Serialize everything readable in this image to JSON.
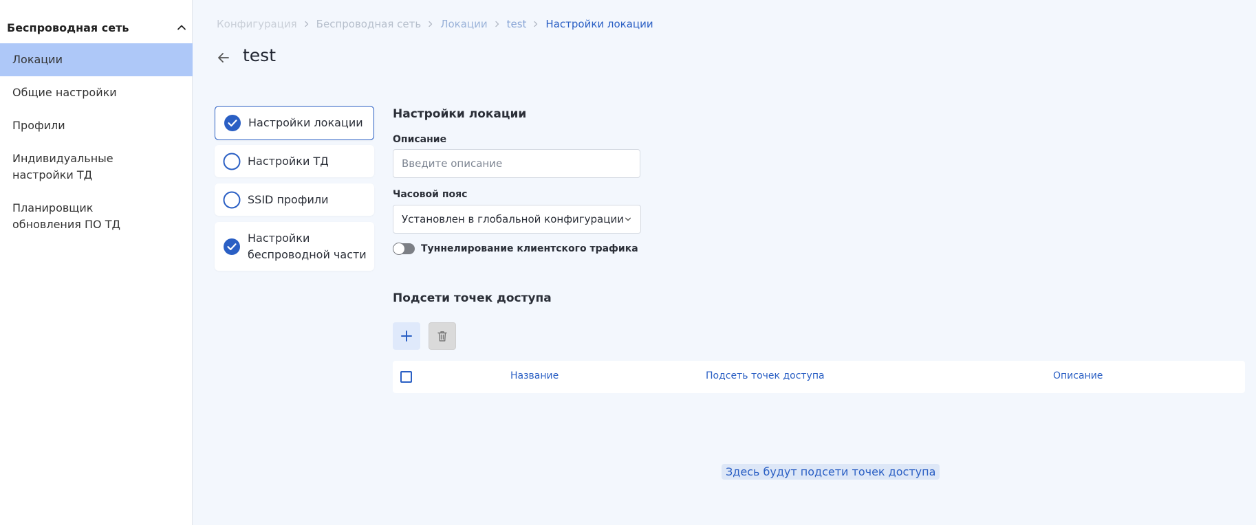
{
  "sidebar": {
    "group_title": "Беспроводная сеть",
    "items": [
      {
        "label": "Локации"
      },
      {
        "label": "Общие настройки"
      },
      {
        "label": "Профили"
      },
      {
        "label": "Индивидуальные",
        "label2": "настройки ТД"
      },
      {
        "label": "Планировщик",
        "label2": "обновления ПО ТД"
      }
    ]
  },
  "breadcrumb": [
    "Конфигурация",
    "Беспроводная сеть",
    "Локации",
    "test",
    "Настройки локации"
  ],
  "page": {
    "title": "test"
  },
  "steps": [
    {
      "label": "Настройки локации",
      "state": "done"
    },
    {
      "label": "Настройки ТД",
      "state": "pending"
    },
    {
      "label": "SSID профили",
      "state": "pending"
    },
    {
      "label": "Настройки",
      "label2": "беспроводной части",
      "state": "done"
    }
  ],
  "form": {
    "section_title": "Настройки локации",
    "description_label": "Описание",
    "description_placeholder": "Введите описание",
    "description_value": "",
    "timezone_label": "Часовой пояс",
    "timezone_value": "Установлен в глобальной конфигурации",
    "tunneling_label": "Туннелирование клиентского трафика",
    "tunneling_enabled": false
  },
  "subnets": {
    "title": "Подсети точек доступа",
    "columns": [
      "Название",
      "Подсеть точек доступа",
      "Описание"
    ],
    "empty_text": "Здесь будут подсети точек доступа"
  },
  "colors": {
    "accent": "#2a5fc4",
    "active_bg": "#aec8f8",
    "page_bg": "#f3f7fd"
  }
}
